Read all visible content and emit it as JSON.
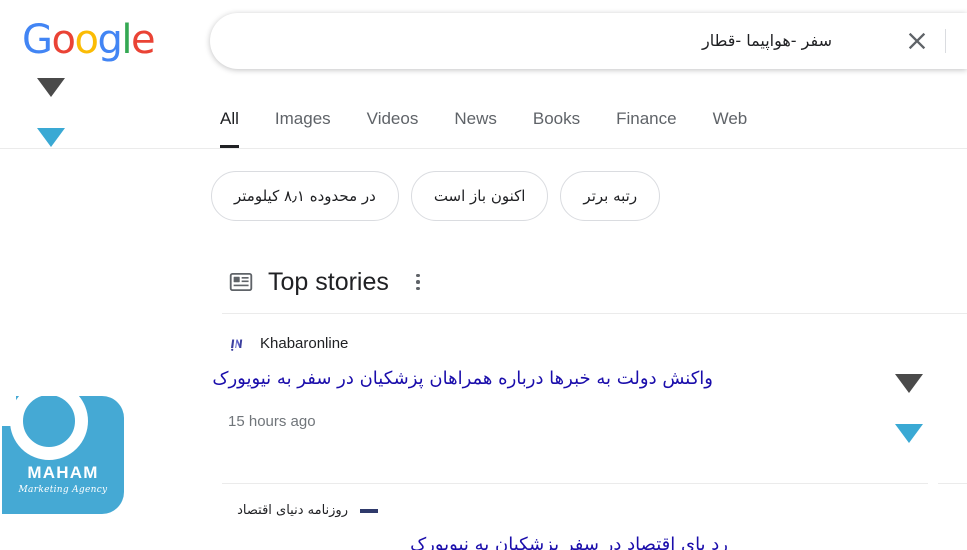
{
  "brand": {
    "logo_text": "Google",
    "logo_letters": [
      {
        "char": "G",
        "color": "#4285F4"
      },
      {
        "char": "o",
        "color": "#EA4335"
      },
      {
        "char": "o",
        "color": "#FBBC05"
      },
      {
        "char": "g",
        "color": "#4285F4"
      },
      {
        "char": "l",
        "color": "#34A853"
      },
      {
        "char": "e",
        "color": "#EA4335"
      }
    ]
  },
  "search": {
    "query": "سفر -هواپیما -قطار",
    "placeholder": "",
    "clear_icon": "close-icon"
  },
  "tabs": [
    {
      "label": "All",
      "active": true
    },
    {
      "label": "Images",
      "active": false
    },
    {
      "label": "Videos",
      "active": false
    },
    {
      "label": "News",
      "active": false
    },
    {
      "label": "Books",
      "active": false
    },
    {
      "label": "Finance",
      "active": false
    },
    {
      "label": "Web",
      "active": false
    }
  ],
  "chips": [
    {
      "label": "در محدوده ۸٫۱ کیلومتر"
    },
    {
      "label": "اکنون باز است"
    },
    {
      "label": "رتبه برتر"
    }
  ],
  "top_stories": {
    "title": "Top stories",
    "icon": "newspaper-icon",
    "menu_icon": "more-vertical-icon",
    "items": [
      {
        "source": "Khabaronline",
        "headline": "واکنش دولت به خبرها درباره همراهان پزشکیان در سفر به نیویورک",
        "time": "15 hours ago"
      },
      {
        "source": "روزنامه دنیای اقتصاد",
        "headline": "رد پای اقتصاد در سفر پزشکیان به نیویورک",
        "time": ""
      }
    ]
  },
  "annotations": {
    "markers": [
      {
        "name": "marker-top-left-dark",
        "color": "#4a4a4a"
      },
      {
        "name": "marker-top-left-cyan",
        "color": "#3aa9d4"
      },
      {
        "name": "marker-right-dark",
        "color": "#4a4a4a"
      },
      {
        "name": "marker-right-cyan",
        "color": "#3aa9d4"
      }
    ]
  },
  "watermark": {
    "name": "MAHAM",
    "tagline": "Marketing Agency",
    "color": "#45a9d4"
  }
}
